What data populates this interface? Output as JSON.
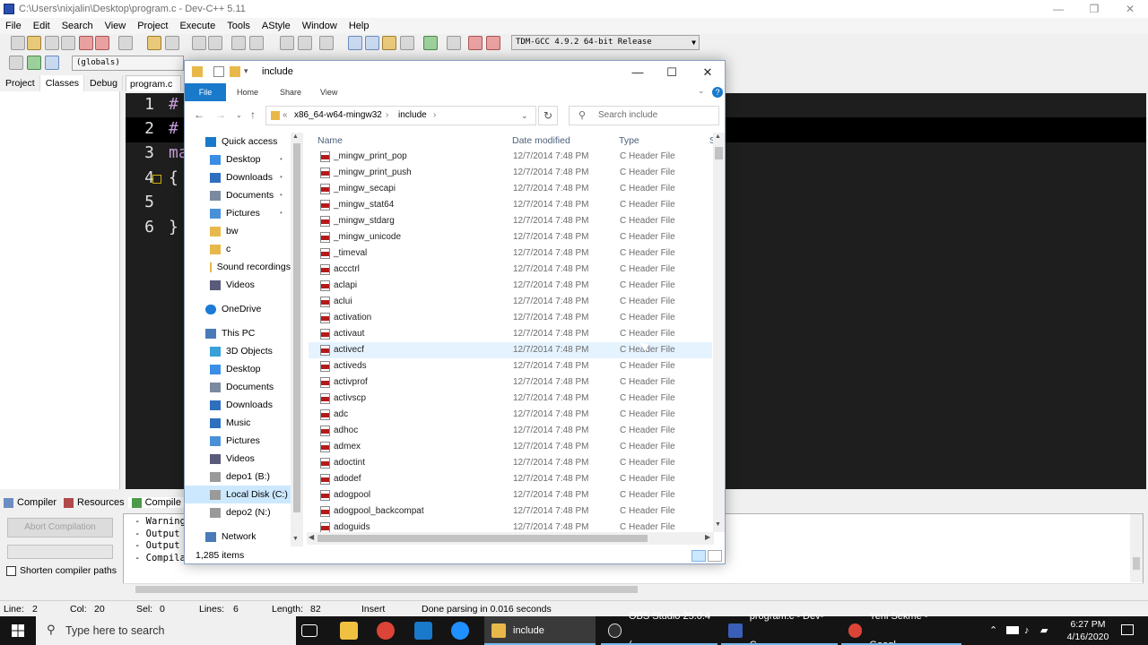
{
  "devcpp": {
    "title": "C:\\Users\\nixjalin\\Desktop\\program.c - Dev-C++ 5.11",
    "menu": [
      "File",
      "Edit",
      "Search",
      "View",
      "Project",
      "Execute",
      "Tools",
      "AStyle",
      "Window",
      "Help"
    ],
    "compiler_select": "TDM-GCC 4.9.2 64-bit Release",
    "globals_select": "(globals)",
    "left_tabs": [
      "Project",
      "Classes",
      "Debug"
    ],
    "file_tab": "program.c",
    "code_lines": [
      {
        "num": "1",
        "text": "#"
      },
      {
        "num": "2",
        "text": "#"
      },
      {
        "num": "3",
        "text": "ma"
      },
      {
        "num": "4",
        "text": "{"
      },
      {
        "num": "5",
        "text": ""
      },
      {
        "num": "6",
        "text": "}"
      }
    ],
    "bottom_tabs": [
      "Compiler",
      "Resources",
      "Compile"
    ],
    "abort_button": "Abort Compilation",
    "shorten_paths": "Shorten compiler paths",
    "log_lines": [
      "- Warnings",
      "- Output F",
      "- Output S",
      "- Compilat"
    ],
    "status": {
      "line_label": "Line:",
      "line_value": "2",
      "col_label": "Col:",
      "col_value": "20",
      "sel_label": "Sel:",
      "sel_value": "0",
      "lines_label": "Lines:",
      "lines_value": "6",
      "length_label": "Length:",
      "length_value": "82",
      "mode": "Insert",
      "message": "Done parsing in 0.016 seconds"
    }
  },
  "explorer": {
    "title": "include",
    "ribbon_tabs": [
      "File",
      "Home",
      "Share",
      "View"
    ],
    "breadcrumb": [
      "x86_64-w64-mingw32",
      "include"
    ],
    "search_placeholder": "Search include",
    "nav": [
      {
        "label": "Quick access",
        "icon": "star-icon",
        "level": 0
      },
      {
        "label": "Desktop",
        "icon": "desktop-icon",
        "level": 1,
        "pinned": true
      },
      {
        "label": "Downloads",
        "icon": "download-icon",
        "level": 1,
        "pinned": true
      },
      {
        "label": "Documents",
        "icon": "documents-icon",
        "level": 1,
        "pinned": true
      },
      {
        "label": "Pictures",
        "icon": "pictures-icon",
        "level": 1,
        "pinned": true
      },
      {
        "label": "bw",
        "icon": "folder-icon",
        "level": 1
      },
      {
        "label": "c",
        "icon": "folder-icon",
        "level": 1
      },
      {
        "label": "Sound recordings",
        "icon": "folder-icon",
        "level": 1
      },
      {
        "label": "Videos",
        "icon": "videos-icon",
        "level": 1
      },
      {
        "label": "OneDrive",
        "icon": "cloud-icon",
        "level": 0
      },
      {
        "label": "This PC",
        "icon": "computer-icon",
        "level": 0
      },
      {
        "label": "3D Objects",
        "icon": "cube-icon",
        "level": 1
      },
      {
        "label": "Desktop",
        "icon": "desktop-icon",
        "level": 1
      },
      {
        "label": "Documents",
        "icon": "documents-icon",
        "level": 1
      },
      {
        "label": "Downloads",
        "icon": "download-icon",
        "level": 1
      },
      {
        "label": "Music",
        "icon": "music-icon",
        "level": 1
      },
      {
        "label": "Pictures",
        "icon": "pictures-icon",
        "level": 1
      },
      {
        "label": "Videos",
        "icon": "videos-icon",
        "level": 1
      },
      {
        "label": "depo1 (B:)",
        "icon": "drive-icon",
        "level": 1
      },
      {
        "label": "Local Disk (C:)",
        "icon": "drive-icon",
        "level": 1,
        "selected": true
      },
      {
        "label": "depo2 (N:)",
        "icon": "drive-icon",
        "level": 1
      },
      {
        "label": "Network",
        "icon": "network-icon",
        "level": 0
      }
    ],
    "columns": [
      "Name",
      "Date modified",
      "Type",
      "S"
    ],
    "files": [
      {
        "name": "_mingw_print_pop",
        "date": "12/7/2014 7:48 PM",
        "type": "C Header File"
      },
      {
        "name": "_mingw_print_push",
        "date": "12/7/2014 7:48 PM",
        "type": "C Header File"
      },
      {
        "name": "_mingw_secapi",
        "date": "12/7/2014 7:48 PM",
        "type": "C Header File"
      },
      {
        "name": "_mingw_stat64",
        "date": "12/7/2014 7:48 PM",
        "type": "C Header File"
      },
      {
        "name": "_mingw_stdarg",
        "date": "12/7/2014 7:48 PM",
        "type": "C Header File"
      },
      {
        "name": "_mingw_unicode",
        "date": "12/7/2014 7:48 PM",
        "type": "C Header File"
      },
      {
        "name": "_timeval",
        "date": "12/7/2014 7:48 PM",
        "type": "C Header File"
      },
      {
        "name": "accctrl",
        "date": "12/7/2014 7:48 PM",
        "type": "C Header File"
      },
      {
        "name": "aclapi",
        "date": "12/7/2014 7:48 PM",
        "type": "C Header File"
      },
      {
        "name": "aclui",
        "date": "12/7/2014 7:48 PM",
        "type": "C Header File"
      },
      {
        "name": "activation",
        "date": "12/7/2014 7:48 PM",
        "type": "C Header File"
      },
      {
        "name": "activaut",
        "date": "12/7/2014 7:48 PM",
        "type": "C Header File"
      },
      {
        "name": "activecf",
        "date": "12/7/2014 7:48 PM",
        "type": "C Header File",
        "hover": true
      },
      {
        "name": "activeds",
        "date": "12/7/2014 7:48 PM",
        "type": "C Header File"
      },
      {
        "name": "activprof",
        "date": "12/7/2014 7:48 PM",
        "type": "C Header File"
      },
      {
        "name": "activscp",
        "date": "12/7/2014 7:48 PM",
        "type": "C Header File"
      },
      {
        "name": "adc",
        "date": "12/7/2014 7:48 PM",
        "type": "C Header File"
      },
      {
        "name": "adhoc",
        "date": "12/7/2014 7:48 PM",
        "type": "C Header File"
      },
      {
        "name": "admex",
        "date": "12/7/2014 7:48 PM",
        "type": "C Header File"
      },
      {
        "name": "adoctint",
        "date": "12/7/2014 7:48 PM",
        "type": "C Header File"
      },
      {
        "name": "adodef",
        "date": "12/7/2014 7:48 PM",
        "type": "C Header File"
      },
      {
        "name": "adogpool",
        "date": "12/7/2014 7:48 PM",
        "type": "C Header File"
      },
      {
        "name": "adogpool_backcompat",
        "date": "12/7/2014 7:48 PM",
        "type": "C Header File"
      },
      {
        "name": "adoguids",
        "date": "12/7/2014 7:48 PM",
        "type": "C Header File"
      }
    ],
    "item_count": "1,285 items"
  },
  "taskbar": {
    "search_placeholder": "Type here to search",
    "apps": [
      {
        "label": "include",
        "color": "#e8b84a",
        "active": true
      },
      {
        "label": "OBS Studio 25.0.4 (...",
        "color": "#303030"
      },
      {
        "label": "program.c - Dev-C...",
        "color": "#3a5fb8"
      },
      {
        "label": "Yeni Sekme - Googl...",
        "color": "#db4437"
      }
    ],
    "time": "6:27 PM",
    "date": "4/16/2020"
  },
  "colors": {
    "accent": "#1979ca",
    "selection": "#cce8ff",
    "editor_bg": "#1e1e1e"
  }
}
